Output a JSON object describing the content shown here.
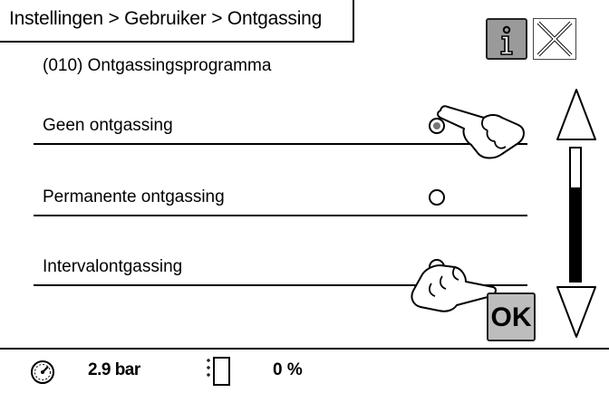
{
  "header": {
    "breadcrumb": "Instellingen > Gebruiker > Ontgassing",
    "info_icon": "info-icon",
    "close_icon": "close-x-icon"
  },
  "parameter": {
    "title": "(010) Ontgassingsprogramma"
  },
  "options": [
    {
      "label": "Geen ontgassing",
      "selected": true
    },
    {
      "label": "Permanente ontgassing",
      "selected": false
    },
    {
      "label": "Intervalontgassing",
      "selected": false
    }
  ],
  "scroll": {
    "up_icon": "triangle-up-icon",
    "down_icon": "triangle-down-icon"
  },
  "ok_button": {
    "label": "OK"
  },
  "status": {
    "pressure_icon": "pressure-gauge-icon",
    "pressure": "2.9 bar",
    "level_icon": "tank-level-icon",
    "level": "0 %"
  },
  "colors": {
    "info_button": "#9a9a9a",
    "ok_button": "#bdbdbd",
    "foreground": "#000000",
    "background": "#ffffff"
  }
}
